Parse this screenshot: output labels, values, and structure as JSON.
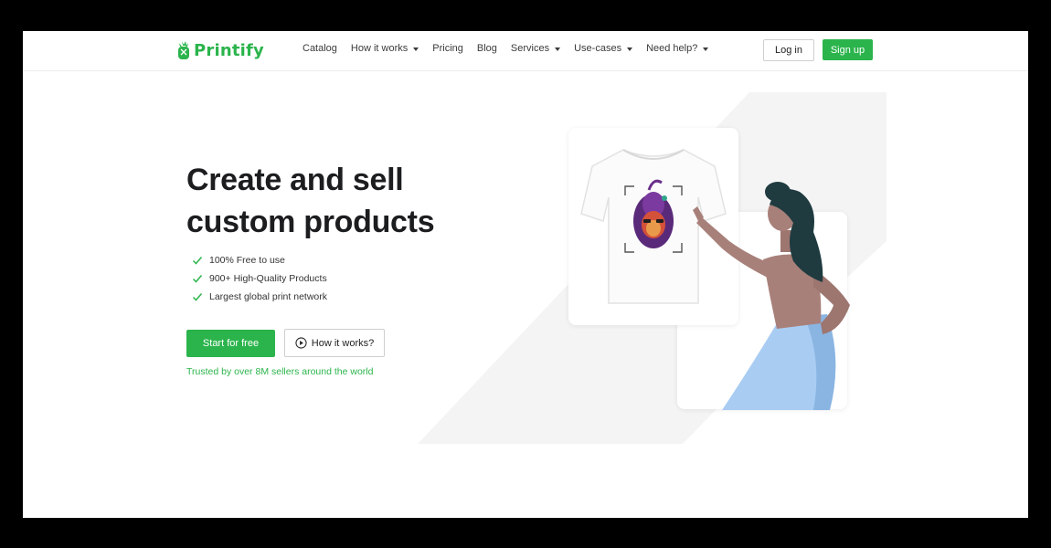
{
  "brand": {
    "name": "Printify",
    "accent_color": "#2bb44c"
  },
  "nav": {
    "links": [
      {
        "label": "Catalog",
        "dropdown": false
      },
      {
        "label": "How it works",
        "dropdown": true
      },
      {
        "label": "Pricing",
        "dropdown": false
      },
      {
        "label": "Blog",
        "dropdown": false
      },
      {
        "label": "Services",
        "dropdown": true
      },
      {
        "label": "Use-cases",
        "dropdown": true
      },
      {
        "label": "Need help?",
        "dropdown": true
      }
    ],
    "login_label": "Log in",
    "signup_label": "Sign up"
  },
  "hero": {
    "title_line1": "Create and sell",
    "title_line2": "custom products",
    "features": [
      "100% Free to use",
      "900+ High-Quality Products",
      "Largest global print network"
    ],
    "start_label": "Start for free",
    "how_label": "How it works?",
    "trusted_text": "Trusted by over 8M sellers around the world"
  },
  "icons": {
    "check": "check-icon",
    "play": "play-circle-icon",
    "logo": "pineapple-logo-icon"
  }
}
